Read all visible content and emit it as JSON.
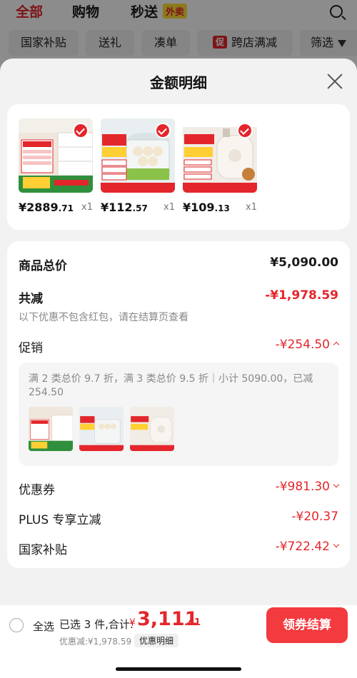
{
  "background": {
    "tabs": [
      {
        "label": "全部",
        "active": true
      },
      {
        "label": "购物",
        "active": false
      },
      {
        "label": "秒送",
        "active": false
      }
    ],
    "waimai_badge": "外卖",
    "filters": [
      "国家补贴",
      "送礼",
      "凑单",
      "跨店满减",
      "筛选"
    ],
    "promo_badge": "促"
  },
  "sheet": {
    "title": "金额明细",
    "products": [
      {
        "price_int": "¥2889",
        "price_dec": ".71",
        "qty": "x1",
        "thumb_icon": "cabinet-product-icon"
      },
      {
        "price_int": "¥112",
        "price_dec": ".57",
        "qty": "x1",
        "thumb_icon": "steamer-product-icon"
      },
      {
        "price_int": "¥109",
        "price_dec": ".13",
        "qty": "x1",
        "thumb_icon": "rice-cooker-product-icon"
      }
    ],
    "breakdown": {
      "total_label": "商品总价",
      "total_value": "¥5,090.00",
      "reduce_label": "共减",
      "reduce_value": "-¥1,978.59",
      "note": "以下优惠不包含红包，请在结算页查看",
      "promo_label": "促销",
      "promo_value": "-¥254.50",
      "promo_detail": "满 2 类总价 9.7 折，满 3 类总价 9.5 折｜小计 5090.00，已减 254.50",
      "coupon_label": "优惠券",
      "coupon_value": "-¥981.30",
      "plus_label": "PLUS 专享立减",
      "plus_value": "-¥20.37",
      "subsidy_label": "国家补贴",
      "subsidy_value": "-¥722.42"
    }
  },
  "bottom": {
    "select_all": "全选",
    "selected_text": "已选 3 件,合计:",
    "currency": "¥",
    "total_int": "3,111",
    "total_dec": ".41",
    "discount_line": "优惠减:¥1,978.59",
    "detail_button": "优惠明细",
    "checkout_button": "领券结算"
  },
  "colors": {
    "accent": "#e3262b",
    "button": "#f23a3f"
  }
}
